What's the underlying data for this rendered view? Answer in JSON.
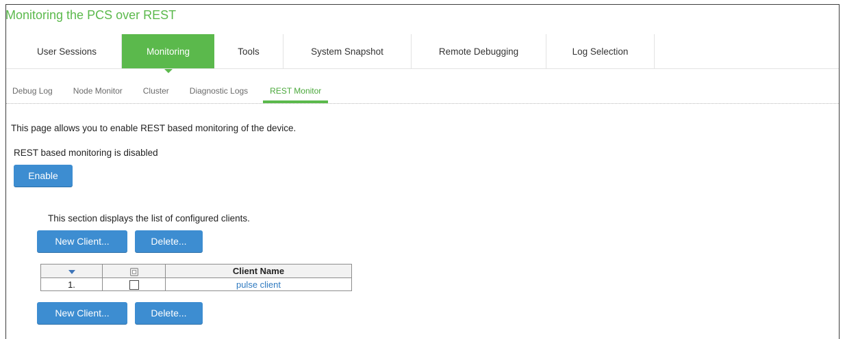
{
  "page": {
    "title": "Monitoring the PCS over REST"
  },
  "tabs": [
    {
      "label": "User Sessions",
      "active": false
    },
    {
      "label": "Monitoring",
      "active": true
    },
    {
      "label": "Tools",
      "active": false
    },
    {
      "label": "System Snapshot",
      "active": false
    },
    {
      "label": "Remote Debugging",
      "active": false
    },
    {
      "label": "Log Selection",
      "active": false
    }
  ],
  "subtabs": [
    {
      "label": "Debug Log",
      "active": false
    },
    {
      "label": "Node Monitor",
      "active": false
    },
    {
      "label": "Cluster",
      "active": false
    },
    {
      "label": "Diagnostic Logs",
      "active": false
    },
    {
      "label": "REST Monitor",
      "active": true
    }
  ],
  "content": {
    "intro": "This page allows you to enable REST based monitoring of the device.",
    "status": "REST based monitoring is disabled",
    "enable_label": "Enable",
    "section_desc": "This section displays the list of configured clients.",
    "new_client_label": "New Client...",
    "delete_label": "Delete..."
  },
  "table": {
    "header_name": "Client Name",
    "rows": [
      {
        "index": "1.",
        "name": "pulse client",
        "checked": false
      }
    ]
  },
  "colors": {
    "accent_green": "#5bb94c",
    "button_blue": "#3d8dd1",
    "link_blue": "#2f7ac0"
  }
}
